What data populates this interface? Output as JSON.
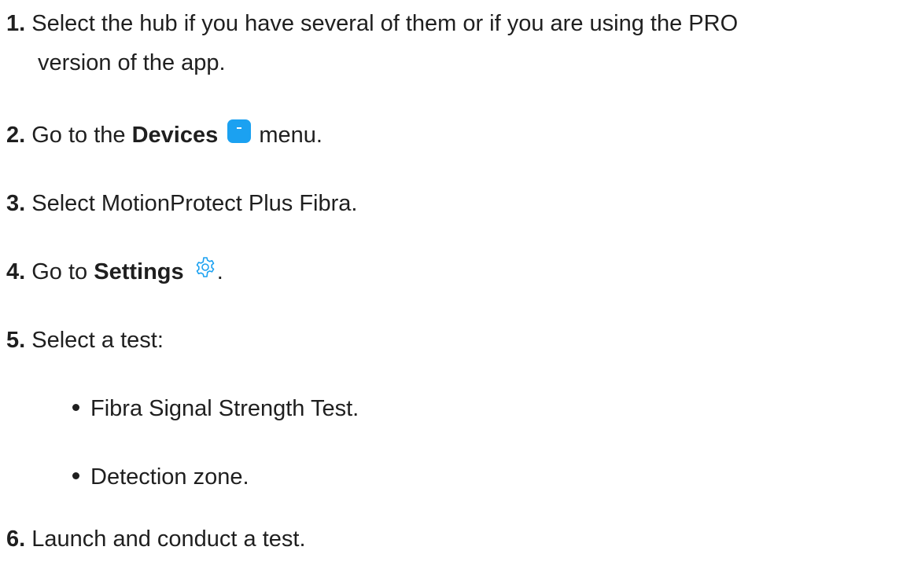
{
  "steps": {
    "s1": {
      "num": "1.",
      "text_line1": " Select the hub if you have several of them or if you are using the PRO",
      "text_line2": "version of the app."
    },
    "s2": {
      "num": "2.",
      "pre": " Go to the ",
      "bold": "Devices",
      "post": " menu.",
      "icon": "devices-icon"
    },
    "s3": {
      "num": "3.",
      "text": " Select MotionProtect Plus Fibra."
    },
    "s4": {
      "num": "4.",
      "pre": " Go to ",
      "bold": "Settings",
      "post": ".",
      "icon": "gear-icon"
    },
    "s5": {
      "num": "5.",
      "text": " Select a test:"
    },
    "s6": {
      "num": "6.",
      "text": " Launch and conduct a test."
    }
  },
  "tests": [
    "Fibra Signal Strength Test.",
    "Detection zone."
  ],
  "colors": {
    "accent": "#1ba1f1",
    "text": "#1f1f1f"
  }
}
